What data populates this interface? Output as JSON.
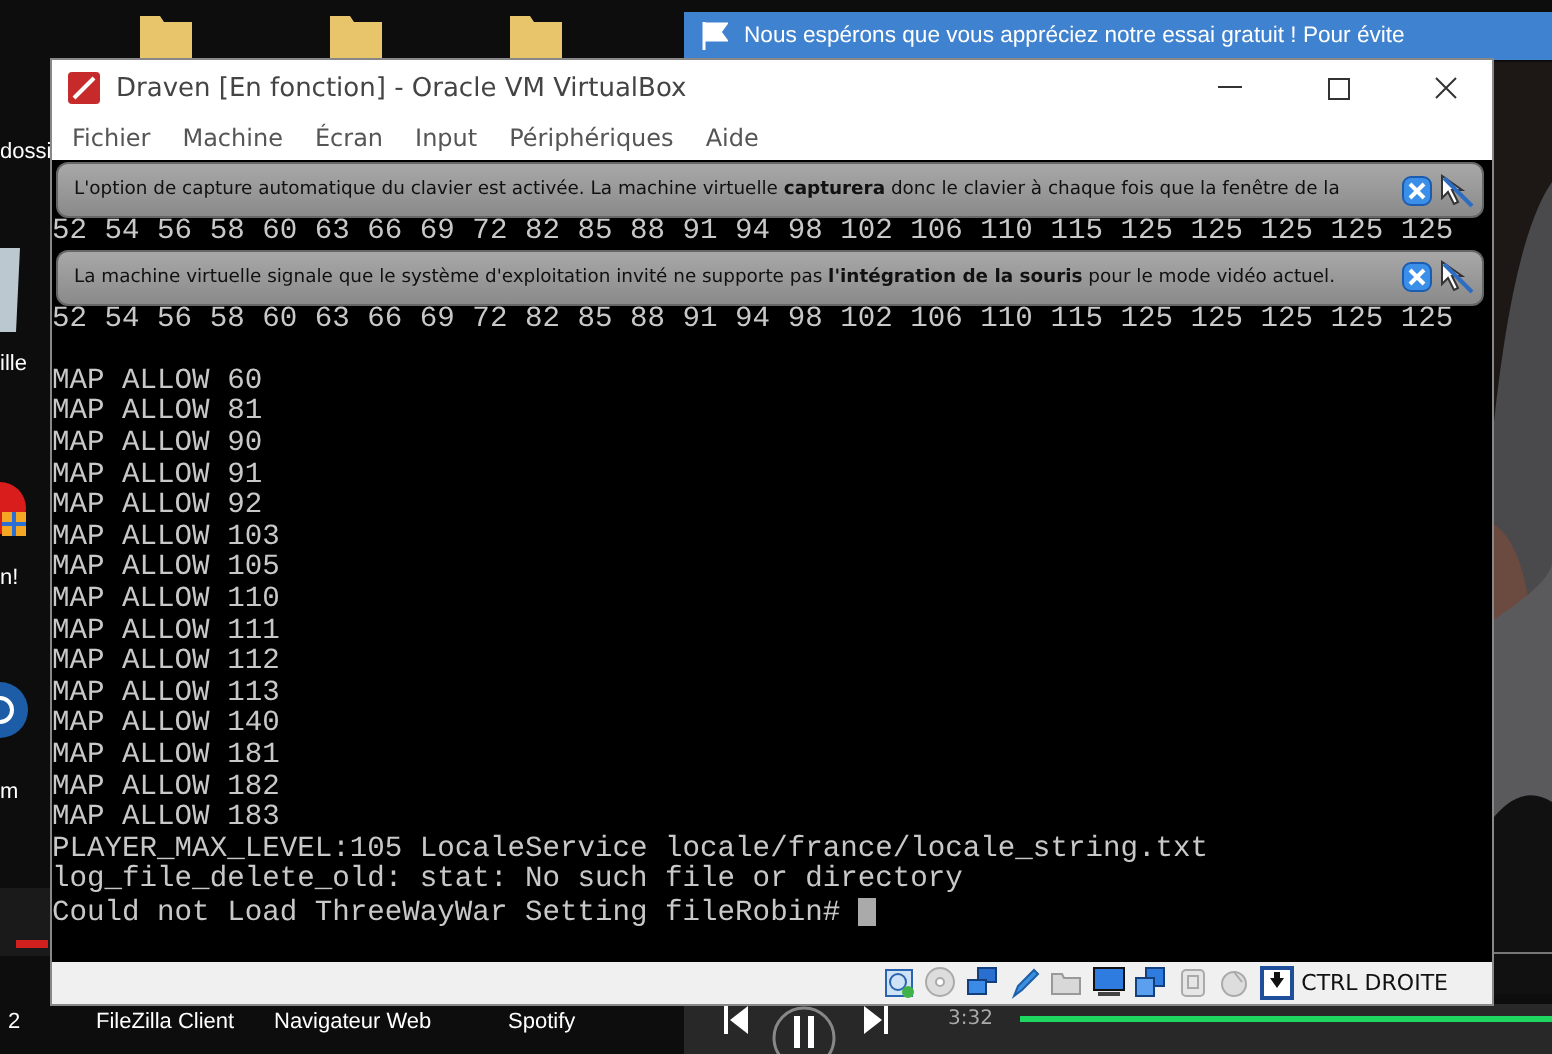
{
  "desktop": {
    "icon_labels": [
      "dossi",
      "ille",
      "n!",
      "m"
    ],
    "bottom_labels": [
      "2",
      "FileZilla Client",
      "Navigateur Web",
      "Spotify"
    ]
  },
  "notification": {
    "text": "Nous espérons que vous appréciez notre essai gratuit ! Pour évite"
  },
  "window": {
    "title": "Draven [En fonction] - Oracle VM VirtualBox",
    "menu": [
      "Fichier",
      "Machine",
      "Écran",
      "Input",
      "Périphériques",
      "Aide"
    ],
    "console": [
      {
        "kind": "banner",
        "text": "L'option de capture automatique du clavier est activée. La machine virtuelle **capturera** donc le clavier à chaque fois que la fenêtre de la"
      },
      {
        "kind": "line",
        "text": "52 54 56 58 60 63 66 69 72 82 85 88 91 94 98 102 106 110 115 125 125 125 125 125"
      },
      {
        "kind": "banner",
        "text": "La machine virtuelle signale que le système d'exploitation invité ne supporte pas **l'intégration de la souris** pour le mode vidéo actuel."
      },
      {
        "kind": "line",
        "text": "52 54 56 58 60 63 66 69 72 82 85 88 91 94 98 102 106 110 115 125 125 125 125 125"
      },
      {
        "kind": "blank"
      },
      {
        "kind": "line",
        "text": "MAP ALLOW 60"
      },
      {
        "kind": "line",
        "text": "MAP ALLOW 81"
      },
      {
        "kind": "line",
        "text": "MAP ALLOW 90"
      },
      {
        "kind": "line",
        "text": "MAP ALLOW 91"
      },
      {
        "kind": "line",
        "text": "MAP ALLOW 92"
      },
      {
        "kind": "line",
        "text": "MAP ALLOW 103"
      },
      {
        "kind": "line",
        "text": "MAP ALLOW 105"
      },
      {
        "kind": "line",
        "text": "MAP ALLOW 110"
      },
      {
        "kind": "line",
        "text": "MAP ALLOW 111"
      },
      {
        "kind": "line",
        "text": "MAP ALLOW 112"
      },
      {
        "kind": "line",
        "text": "MAP ALLOW 113"
      },
      {
        "kind": "line",
        "text": "MAP ALLOW 140"
      },
      {
        "kind": "line",
        "text": "MAP ALLOW 181"
      },
      {
        "kind": "line",
        "text": "MAP ALLOW 182"
      },
      {
        "kind": "line",
        "text": "MAP ALLOW 183"
      },
      {
        "kind": "line",
        "text": "PLAYER_MAX_LEVEL:105 LocaleService locale/france/locale_string.txt"
      },
      {
        "kind": "line",
        "text": "log_file_delete_old: stat: No such file or directory"
      },
      {
        "kind": "prompt",
        "text": "Could not Load ThreeWayWar Setting fileRobin#"
      }
    ],
    "status_bar": {
      "host_key": "CTRL DROITE"
    }
  },
  "player": {
    "time": "3:32",
    "level": 1
  }
}
